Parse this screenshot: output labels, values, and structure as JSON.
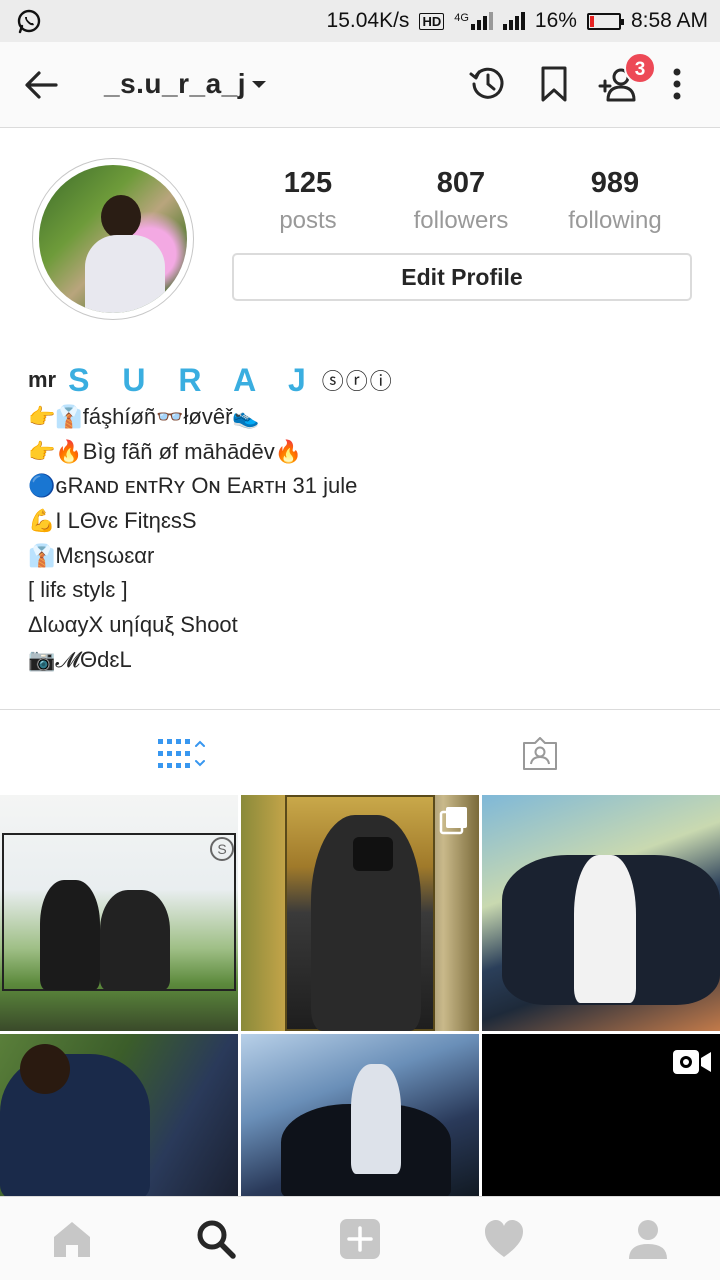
{
  "status_bar": {
    "speed": "15.04K/s",
    "network_hd": "HD",
    "network_type": "4G",
    "battery_percent": "16%",
    "battery_level": 0.16,
    "time": "8:58 AM",
    "notification_icon": "whatsapp-icon"
  },
  "top_nav": {
    "username": "_s.u_r_a_j",
    "notification_count": "3",
    "icons": [
      "back-arrow-icon",
      "archive-history-icon",
      "bookmark-icon",
      "discover-people-icon",
      "more-options-icon"
    ]
  },
  "profile": {
    "stats": [
      {
        "value": "125",
        "label": "posts"
      },
      {
        "value": "807",
        "label": "followers"
      },
      {
        "value": "989",
        "label": "following"
      }
    ],
    "edit_button": "Edit Profile"
  },
  "bio": {
    "prefix": "mr",
    "name": "S U R A J",
    "name_marks": "ⓢⓡⓘ",
    "lines": [
      "👉👔fáşhíøñ👓łøvêř👟",
      "👉🔥Bìg fãñ øf māhādēv🔥",
      "🔵ɢRᴀɴᴅ ᴇɴᴛRʏ Oɴ Eᴀʀᴛʜ 31 jule",
      " 💪I LΘvɛ FitηɛsS",
      "👔Mɛηsωɛαr",
      "[ lifɛ stylɛ ]",
      "ΔlωαyX uηíquξ Shoot",
      "📷𝓜ΘdɛL"
    ]
  },
  "tabs": {
    "grid": "grid-view-icon",
    "tagged": "tagged-photos-icon"
  },
  "bottom_nav": [
    "home-icon",
    "search-icon",
    "add-post-icon",
    "activity-heart-icon",
    "profile-icon"
  ],
  "colors": {
    "accent_blue": "#3897f0",
    "badge_red": "#ed4956",
    "name_blue": "#3aaee0",
    "battery_red": "#e52222"
  }
}
